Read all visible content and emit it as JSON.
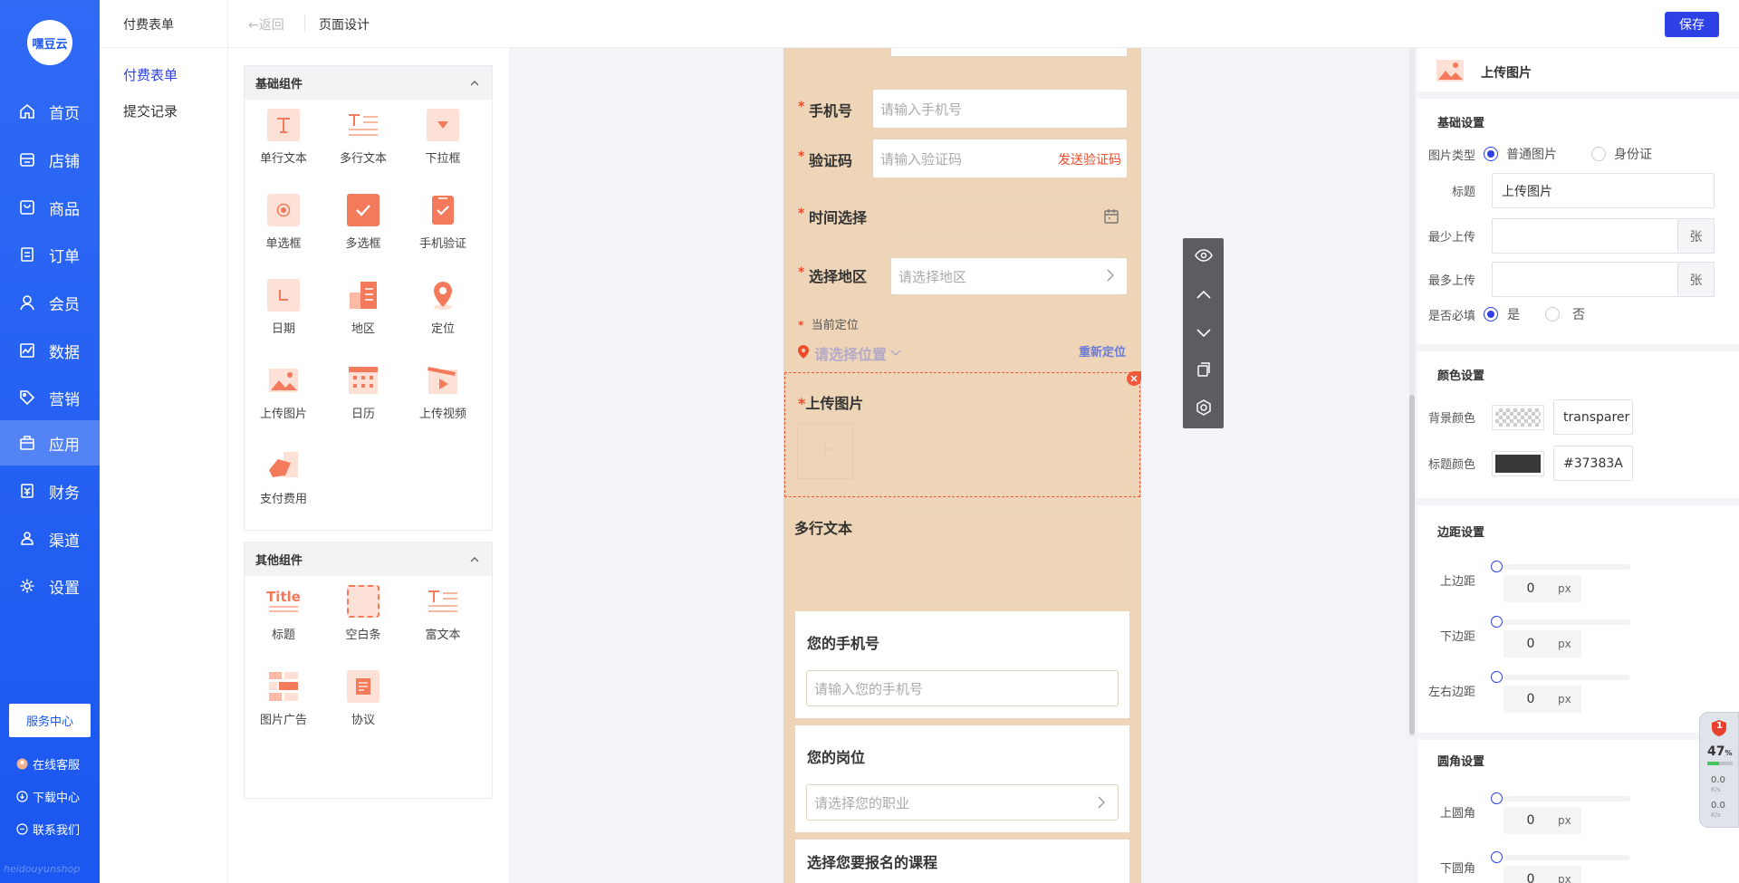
{
  "brand": {
    "logo_text": "嘿豆云",
    "watermark": "heidouyunshop"
  },
  "nav": {
    "items": [
      {
        "label": "首页",
        "icon": "home-icon"
      },
      {
        "label": "店铺",
        "icon": "store-icon"
      },
      {
        "label": "商品",
        "icon": "goods-icon"
      },
      {
        "label": "订单",
        "icon": "order-icon"
      },
      {
        "label": "会员",
        "icon": "member-icon"
      },
      {
        "label": "数据",
        "icon": "chart-icon"
      },
      {
        "label": "营销",
        "icon": "tag-icon"
      },
      {
        "label": "应用",
        "icon": "app-icon"
      },
      {
        "label": "财务",
        "icon": "finance-icon"
      },
      {
        "label": "渠道",
        "icon": "channel-icon"
      },
      {
        "label": "设置",
        "icon": "gear-icon"
      }
    ],
    "active": "应用",
    "service_center": "服务中心",
    "online_service": "在线客服",
    "download_center": "下载中心",
    "contact_us": "联系我们"
  },
  "subnav": {
    "title": "付费表单",
    "items": [
      "付费表单",
      "提交记录"
    ]
  },
  "topbar": {
    "back": "返回",
    "breadcrumb": "页面设计",
    "save": "保存"
  },
  "library": {
    "basic_title": "基础组件",
    "basic": [
      {
        "label": "单行文本",
        "icon": "single-text-icon"
      },
      {
        "label": "多行文本",
        "icon": "multi-text-icon"
      },
      {
        "label": "下拉框",
        "icon": "dropdown-icon"
      },
      {
        "label": "单选框",
        "icon": "radio-icon"
      },
      {
        "label": "多选框",
        "icon": "checkbox-icon"
      },
      {
        "label": "手机验证",
        "icon": "phone-verify-icon"
      },
      {
        "label": "日期",
        "icon": "date-icon"
      },
      {
        "label": "地区",
        "icon": "region-icon"
      },
      {
        "label": "定位",
        "icon": "location-icon"
      },
      {
        "label": "上传图片",
        "icon": "upload-image-icon"
      },
      {
        "label": "日历",
        "icon": "calendar-icon"
      },
      {
        "label": "上传视频",
        "icon": "upload-video-icon"
      },
      {
        "label": "支付费用",
        "icon": "payment-icon"
      }
    ],
    "other_title": "其他组件",
    "other": [
      {
        "label": "标题",
        "icon": "title-icon",
        "icon_text": "Title"
      },
      {
        "label": "空白条",
        "icon": "blank-icon"
      },
      {
        "label": "富文本",
        "icon": "rich-text-icon"
      },
      {
        "label": "图片广告",
        "icon": "image-ad-icon"
      },
      {
        "label": "协议",
        "icon": "agreement-icon"
      }
    ]
  },
  "form": {
    "phone_label": "手机号",
    "phone_placeholder": "请输入手机号",
    "code_label": "验证码",
    "code_placeholder": "请输入验证码",
    "code_send": "发送验证码",
    "time_label": "时间选择",
    "region_label": "选择地区",
    "region_placeholder": "请选择地区",
    "location_label": "当前定位",
    "location_placeholder": "请选择位置",
    "relocate": "重新定位",
    "upload_label": "上传图片",
    "multiline_label": "多行文本",
    "your_phone_title": "您的手机号",
    "your_phone_placeholder": "请输入您的手机号",
    "job_title": "您的岗位",
    "job_placeholder": "请选择您的职业",
    "course_title": "选择您要报名的课程"
  },
  "props": {
    "header_title": "上传图片",
    "basic_title": "基础设置",
    "image_type_label": "图片类型",
    "image_type_options": [
      "普通图片",
      "身份证"
    ],
    "image_type_selected": "普通图片",
    "title_label": "标题",
    "title_value": "上传图片",
    "min_label": "最少上传",
    "max_label": "最多上传",
    "unit": "张",
    "required_label": "是否必填",
    "required_options": [
      "是",
      "否"
    ],
    "required_selected": "是",
    "color_title": "颜色设置",
    "bg_color_label": "背景颜色",
    "bg_color_value": "transparer",
    "title_color_label": "标题颜色",
    "title_color_value": "#37383A",
    "margin_title": "边距设置",
    "margins": [
      {
        "label": "上边距",
        "value": "0"
      },
      {
        "label": "下边距",
        "value": "0"
      },
      {
        "label": "左右边距",
        "value": "0"
      }
    ],
    "radius_title": "圆角设置",
    "radii": [
      {
        "label": "上圆角",
        "value": "0"
      },
      {
        "label": "下圆角",
        "value": "0"
      }
    ],
    "px": "px"
  },
  "monitor": {
    "badge": "1",
    "percent": "47",
    "unit": "%",
    "up": "0.0",
    "down": "0.0",
    "rate_unit": "K/s"
  },
  "colors": {
    "primary": "#2d41e6",
    "nav": "#1b57f0",
    "canvas": "#eed5b7",
    "accent": "#f47a5c",
    "title_color": "#37383A"
  }
}
